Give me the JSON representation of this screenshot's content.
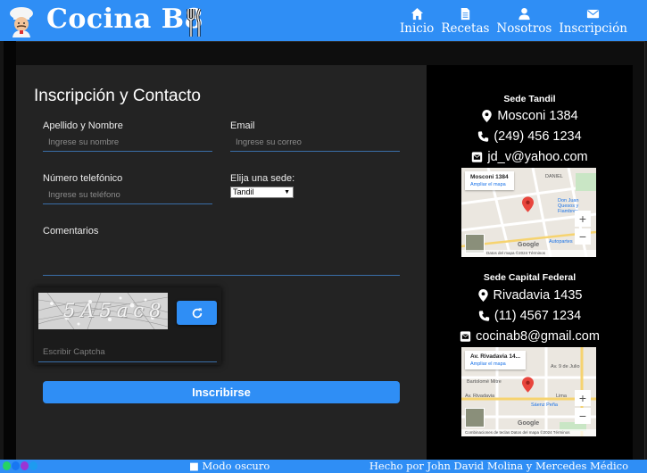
{
  "header": {
    "brand": "Cocina B8",
    "nav": [
      {
        "label": "Inicio",
        "icon": "home-icon"
      },
      {
        "label": "Recetas",
        "icon": "document-icon"
      },
      {
        "label": "Nosotros",
        "icon": "user-icon"
      },
      {
        "label": "Inscripción",
        "icon": "envelope-icon"
      }
    ]
  },
  "form": {
    "title": "Inscripción y Contacto",
    "name_label": "Apellido y Nombre",
    "name_placeholder": "Ingrese su nombre",
    "email_label": "Email",
    "email_placeholder": "Ingrese su correo",
    "phone_label": "Número telefónico",
    "phone_placeholder": "Ingrese su teléfono",
    "sede_label": "Elija una sede:",
    "sede_selected": "Tandil",
    "comments_label": "Comentarios",
    "captcha_text": "5A5ac8",
    "captcha_placeholder": "Escribir Captcha",
    "submit_label": "Inscribirse"
  },
  "sedes": [
    {
      "title": "Sede Tandil",
      "address": "Mosconi 1384",
      "phone": "(249) 456 1234",
      "email": "jd_v@yahoo.com",
      "map": {
        "card_title": "Mosconi 1384",
        "card_link": "Ampliar el mapa",
        "labels": [
          "DANIEL",
          "Don Juan Quesos y Fiambres",
          "Autopartes"
        ],
        "footer": "Datos del mapa ©2024   Términos"
      }
    },
    {
      "title": "Sede Capital Federal",
      "address": "Rivadavia 1435",
      "phone": "(11) 4567 1234",
      "email": "cocinab8@gmail.com",
      "map": {
        "card_title": "Av. Rivadavia 14...",
        "card_link": "Ampliar el mapa",
        "labels": [
          "Av. 9 de Julio",
          "Bartolomé Mitre",
          "Av. Rivadavia",
          "Sáenz Peña",
          "Lima"
        ],
        "footer": "Combinaciones de teclas   Datos del mapa ©2024   Términos"
      }
    }
  ],
  "map_brand": "Google",
  "footer": {
    "dark_mode_label": "■ Modo oscuro",
    "credits": "Hecho por John David Molina y Mercedes Médico"
  },
  "colors": {
    "accent": "#2f8ef5",
    "panel": "#232323",
    "background": "#0e0e0e"
  }
}
